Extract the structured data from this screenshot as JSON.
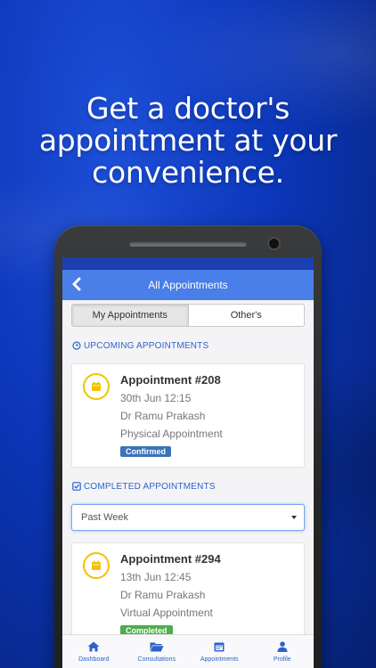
{
  "promo": {
    "headline_lines": [
      "Get a doctor's",
      "appointment at your",
      "convenience."
    ]
  },
  "appbar": {
    "title": "All Appointments"
  },
  "tabs": [
    {
      "label": "My Appointments",
      "active": true
    },
    {
      "label": "Other's",
      "active": false
    }
  ],
  "upcoming": {
    "heading": "UPCOMING APPOINTMENTS",
    "appointments": [
      {
        "title": "Appointment #208",
        "datetime": "30th Jun 12:15",
        "doctor": "Dr Ramu Prakash",
        "type": "Physical Appointment",
        "status": "Confirmed"
      }
    ]
  },
  "completed": {
    "heading": "COMPLETED APPOINTMENTS",
    "filter": {
      "selected": "Past Week"
    },
    "appointments": [
      {
        "title": "Appointment #294",
        "datetime": "13th Jun 12:45",
        "doctor": "Dr Ramu Prakash",
        "type": "Virtual Appointment",
        "status": "Completed"
      }
    ]
  },
  "bottom_nav": [
    {
      "label": "Dashboard",
      "icon": "home-icon"
    },
    {
      "label": "Consultations",
      "icon": "folder-icon"
    },
    {
      "label": "Appointments",
      "icon": "calendar-icon"
    },
    {
      "label": "Profile",
      "icon": "user-icon"
    }
  ],
  "colors": {
    "background": "#0b36b8",
    "appbar": "#4a7ee8",
    "accent": "#2d63c8",
    "confirmed": "#3a74b8",
    "completed": "#4cae4c",
    "calendar_ring": "#f2c200"
  }
}
